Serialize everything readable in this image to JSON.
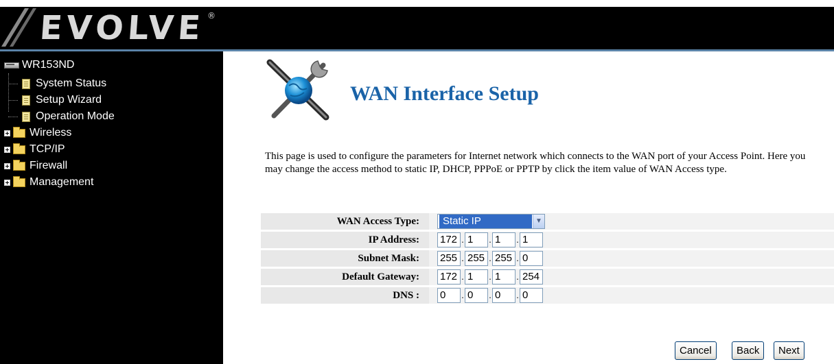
{
  "header": {
    "brand": "EVOLVE",
    "trademark": "®"
  },
  "sidebar": {
    "root_label": "WR153ND",
    "pages": [
      {
        "label": "System Status"
      },
      {
        "label": "Setup Wizard"
      },
      {
        "label": "Operation Mode"
      }
    ],
    "folders": [
      {
        "label": "Wireless"
      },
      {
        "label": "TCP/IP"
      },
      {
        "label": "Firewall"
      },
      {
        "label": "Management"
      }
    ]
  },
  "main": {
    "title": "WAN Interface Setup",
    "description": "This page is used to configure the parameters for Internet network which connects to the WAN port of your Access Point. Here you may change the access method to static IP, DHCP, PPPoE or PPTP by click the item value of WAN Access type."
  },
  "form": {
    "wan_access_type": {
      "label": "WAN Access Type:",
      "value": "Static IP"
    },
    "ip_address": {
      "label": "IP Address:",
      "octets": [
        "172",
        "1",
        "1",
        "1"
      ]
    },
    "subnet_mask": {
      "label": "Subnet Mask:",
      "octets": [
        "255",
        "255",
        "255",
        "0"
      ]
    },
    "default_gateway": {
      "label": "Default Gateway:",
      "octets": [
        "172",
        "1",
        "1",
        "254"
      ]
    },
    "dns": {
      "label": "DNS :",
      "octets": [
        "0",
        "0",
        "0",
        "0"
      ]
    }
  },
  "buttons": {
    "cancel": "Cancel",
    "back": "Back",
    "next": "Next"
  },
  "colors": {
    "header_bg": "#000000",
    "title": "#1a63a8",
    "select_highlight": "#316ac5"
  }
}
